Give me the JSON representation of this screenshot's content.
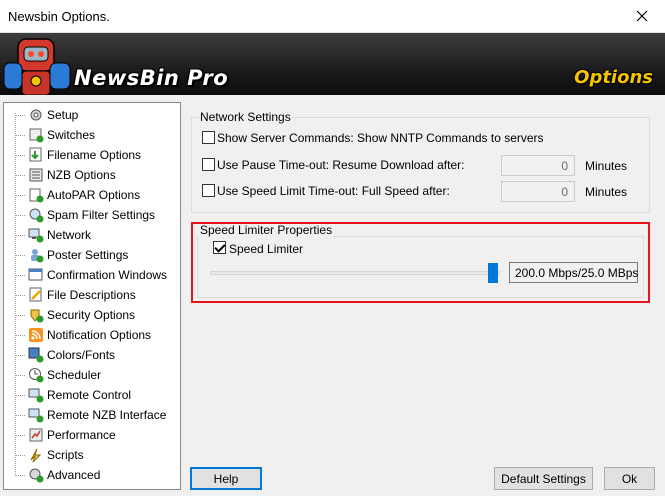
{
  "window": {
    "title": "Newsbin Options."
  },
  "banner": {
    "brand": "NewsBin Pro",
    "section": "Options"
  },
  "tree": {
    "items": [
      {
        "label": "Setup",
        "icon": "gear-icon"
      },
      {
        "label": "Switches",
        "icon": "switches-icon"
      },
      {
        "label": "Filename Options",
        "icon": "download-icon"
      },
      {
        "label": "NZB Options",
        "icon": "nzb-icon"
      },
      {
        "label": "AutoPAR Options",
        "icon": "autopar-icon"
      },
      {
        "label": "Spam Filter Settings",
        "icon": "spam-filter-icon"
      },
      {
        "label": "Network",
        "icon": "network-icon"
      },
      {
        "label": "Poster Settings",
        "icon": "poster-icon"
      },
      {
        "label": "Confirmation Windows",
        "icon": "confirmation-icon"
      },
      {
        "label": "File Descriptions",
        "icon": "file-description-icon"
      },
      {
        "label": "Security Options",
        "icon": "security-icon"
      },
      {
        "label": "Notification Options",
        "icon": "rss-icon"
      },
      {
        "label": "Colors/Fonts",
        "icon": "colors-icon"
      },
      {
        "label": "Scheduler",
        "icon": "scheduler-icon"
      },
      {
        "label": "Remote Control",
        "icon": "remote-control-icon"
      },
      {
        "label": "Remote NZB Interface",
        "icon": "remote-nzb-icon"
      },
      {
        "label": "Performance",
        "icon": "performance-icon"
      },
      {
        "label": "Scripts",
        "icon": "scripts-icon"
      },
      {
        "label": "Advanced",
        "icon": "advanced-icon"
      }
    ],
    "selected": "Network"
  },
  "network_settings": {
    "title": "Network Settings",
    "show_server_commands": {
      "label": "Show Server Commands:  Show NNTP Commands to servers",
      "checked": false
    },
    "pause_timeout": {
      "label": "Use Pause Time-out: Resume Download after:",
      "checked": false,
      "value": "0",
      "unit": "Minutes"
    },
    "speed_limit_timeout": {
      "label": "Use Speed Limit Time-out: Full Speed after:",
      "checked": false,
      "value": "0",
      "unit": "Minutes"
    }
  },
  "speed_limiter": {
    "title": "Speed Limiter Properties",
    "checkbox_label": "Speed Limiter",
    "checked": true,
    "slider_level": 1.0,
    "readout": "200.0 Mbps/25.0 MBps"
  },
  "buttons": {
    "help": "Help",
    "default_settings": "Default Settings",
    "ok": "Ok"
  },
  "colors": {
    "highlight": "#e8141b",
    "accent": "#0078d7",
    "banner_text": "#f5c400"
  }
}
